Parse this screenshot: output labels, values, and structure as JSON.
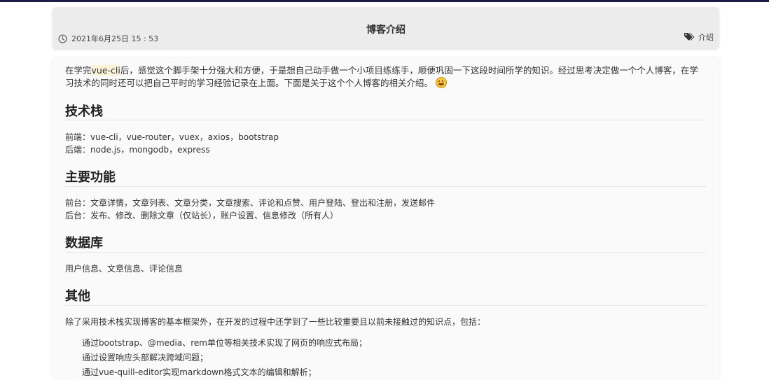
{
  "post": {
    "title": "博客介绍",
    "date": "2021年6月25日 15 : 53",
    "tag": "介绍"
  },
  "intro": {
    "before": "在学完",
    "highlight": "vue-cli",
    "after": "后，感觉这个脚手架十分强大和方便，于是想自己动手做一个小项目练练手，顺便巩固一下这段时间所学的知识。经过思考决定做一个个人博客，在学习技术的同时还可以把自己平时的学习经验记录在上面。下面是关于这个个人博客的相关介绍。"
  },
  "sections": [
    {
      "heading": "技术栈",
      "lines": [
        "前端：vue-cli，vue-router，vuex，axios，bootstrap",
        "后端：node.js，mongodb，express"
      ]
    },
    {
      "heading": "主要功能",
      "lines": [
        "前台：文章详情，文章列表、文章分类，文章搜索、评论和点赞、用户登陆、登出和注册，发送邮件",
        "后台：发布、修改、删除文章（仅站长），账户设置、信息修改（所有人）"
      ]
    },
    {
      "heading": "数据库",
      "lines": [
        "用户信息、文章信息、评论信息"
      ]
    },
    {
      "heading": "其他",
      "lines": [
        "除了采用技术栈实现博客的基本框架外，在开发的过程中还学到了一些比较重要且以前未接触过的知识点，包括："
      ],
      "list": [
        "通过bootstrap、@media、rem单位等相关技术实现了网页的响应式布局；",
        "通过设置响应头部解决跨域问题；",
        "通过vue-quill-editor实现markdown格式文本的编辑和解析；"
      ]
    }
  ],
  "icons": {
    "date": "clock-icon",
    "tag": "tags-icon",
    "emoji": "grinning-face-emoji"
  },
  "colors": {
    "topbar": "#1d1b4a",
    "header_bg": "#ececec",
    "content_bg": "#fafafa",
    "highlight": "#fbf3d9"
  }
}
